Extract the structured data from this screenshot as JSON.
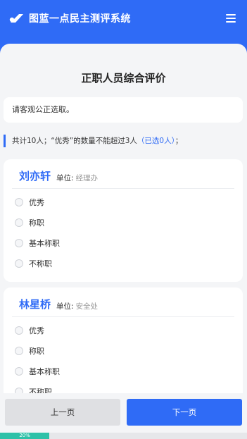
{
  "header": {
    "brand_title": "图蓝一点民主测评系统"
  },
  "main": {
    "page_title": "正职人员综合评价",
    "notice": "请客观公正选取。",
    "rule": {
      "prefix": "共计10人；“优秀”的数量不能超过3人",
      "selected": "（已选0人）",
      "suffix": "；"
    },
    "unit_label": "单位:",
    "candidates": [
      {
        "name": "刘亦轩",
        "unit": "经理办",
        "options": [
          "优秀",
          "称职",
          "基本称职",
          "不称职"
        ]
      },
      {
        "name": "林星桥",
        "unit": "安全处",
        "options": [
          "优秀",
          "称职",
          "基本称职",
          "不称职"
        ]
      }
    ]
  },
  "footer": {
    "prev_label": "上一页",
    "next_label": "下一页",
    "progress_text": "20%",
    "progress_percent": 20
  },
  "colors": {
    "primary": "#2f6bf6",
    "progress": "#2ec1a8"
  },
  "icons": {
    "logo": "brand-logo-icon",
    "menu": "hamburger-menu-icon"
  }
}
